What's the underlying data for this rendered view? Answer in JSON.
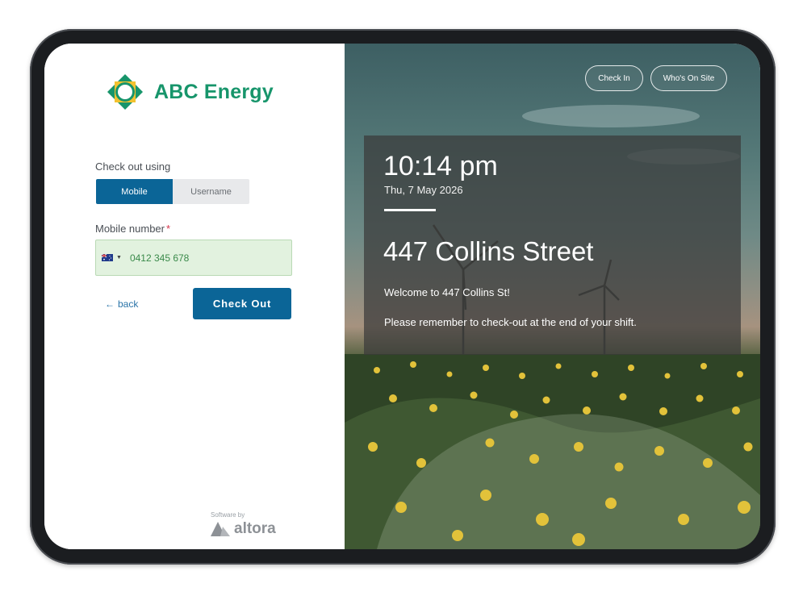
{
  "brand": {
    "name": "ABC Energy",
    "color": "#17956b"
  },
  "form": {
    "method_label": "Check out using",
    "methods": [
      {
        "label": "Mobile",
        "selected": true
      },
      {
        "label": "Username",
        "selected": false
      }
    ],
    "mobile_label": "Mobile number",
    "required_marker": "*",
    "country_flag_icon": "australia-flag-icon",
    "mobile_value": "0412 345 678",
    "back_arrow": "←",
    "back_label": "back",
    "submit_label": "Check Out",
    "accent": "#0b6597"
  },
  "footer": {
    "powered_by": "Software by",
    "vendor": "altora"
  },
  "kiosk": {
    "nav": [
      {
        "label": "Check In"
      },
      {
        "label": "Who's On Site"
      }
    ],
    "time": "10:14 pm",
    "date": "Thu, 7 May 2026",
    "site_name": "447 Collins Street",
    "welcome": "Welcome to 447 Collins St!",
    "reminder": "Please remember to check-out at the end of your shift."
  }
}
